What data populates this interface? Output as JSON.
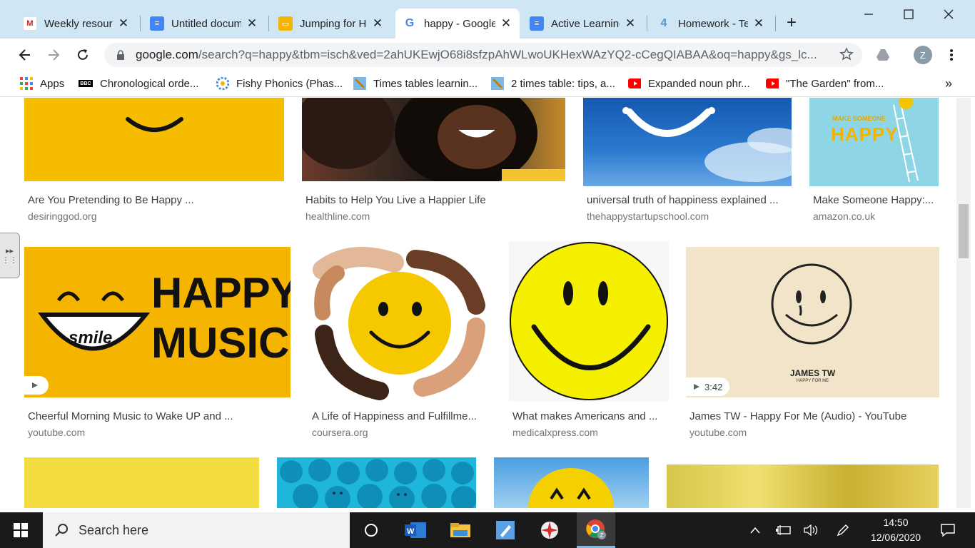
{
  "tabs": [
    {
      "title": "Weekly resources",
      "icon": "gmail-icon"
    },
    {
      "title": "Untitled document",
      "icon": "docs-icon"
    },
    {
      "title": "Jumping for Happiness",
      "icon": "slides-icon"
    },
    {
      "title": "happy - Google Search",
      "icon": "google-icon",
      "active": true
    },
    {
      "title": "Active Learning",
      "icon": "docs-icon"
    },
    {
      "title": "Homework - Teams",
      "icon": "teams-icon"
    }
  ],
  "tab_close": "✕",
  "new_tab": "+",
  "toolbar": {
    "url_host": "google.com",
    "url_path": "/search?q=happy&tbm=isch&ved=2ahUKEwjO68i8sfzpAhWLwoUKHexWAzYQ2-cCegQIABAA&oq=happy&gs_lc...",
    "avatar_letter": "Z"
  },
  "bookmarks": [
    {
      "label": "Apps",
      "icon": "apps-grid-icon"
    },
    {
      "label": "Chronological orde...",
      "icon": "bbc-icon"
    },
    {
      "label": "Fishy Phonics (Phas...",
      "icon": "flower-icon"
    },
    {
      "label": "Times tables learnin...",
      "icon": "pencil-icon"
    },
    {
      "label": "2 times table: tips, a...",
      "icon": "pencil-icon"
    },
    {
      "label": "Expanded noun phr...",
      "icon": "youtube-icon"
    },
    {
      "label": "\"The Garden\" from...",
      "icon": "youtube-icon"
    }
  ],
  "bookmarks_more": "»",
  "results_row1": [
    {
      "caption": "Are You Pretending to Be Happy ...",
      "domain": "desiringgod.org"
    },
    {
      "caption": "Habits to Help You Live a Happier Life",
      "domain": "healthline.com"
    },
    {
      "caption": "universal truth of happiness explained ...",
      "domain": "thehappystartupschool.com"
    },
    {
      "caption": "Make Someone Happy:...",
      "domain": "amazon.co.uk"
    }
  ],
  "results_row2": [
    {
      "caption": "Cheerful Morning Music to Wake UP and ...",
      "domain": "youtube.com"
    },
    {
      "caption": "A Life of Happiness and Fulfillme...",
      "domain": "coursera.org"
    },
    {
      "caption": "What makes Americans and ...",
      "domain": "medicalxpress.com"
    },
    {
      "caption": "James TW - Happy For Me (Audio) - YouTube",
      "domain": "youtube.com"
    }
  ],
  "image_text": {
    "happy_music_line1": "HAPPY",
    "happy_music_line2": "MUSIC",
    "smile_word": "smile",
    "book_title_small": "MAKE SOMEONE",
    "book_title_big": "HAPPY",
    "james_tw": "JAMES TW",
    "happy_for_me": "HAPPY FOR ME"
  },
  "video_durations": {
    "james_tw": "3:42"
  },
  "taskbar": {
    "search_placeholder": "Search here",
    "time": "14:50",
    "date": "12/06/2020"
  },
  "colors": {
    "tabstrip": "#cfe6f5",
    "yellow": "#f5bc00",
    "smiley_yellow": "#f5f000",
    "sky_blue": "#1b6fc4"
  }
}
